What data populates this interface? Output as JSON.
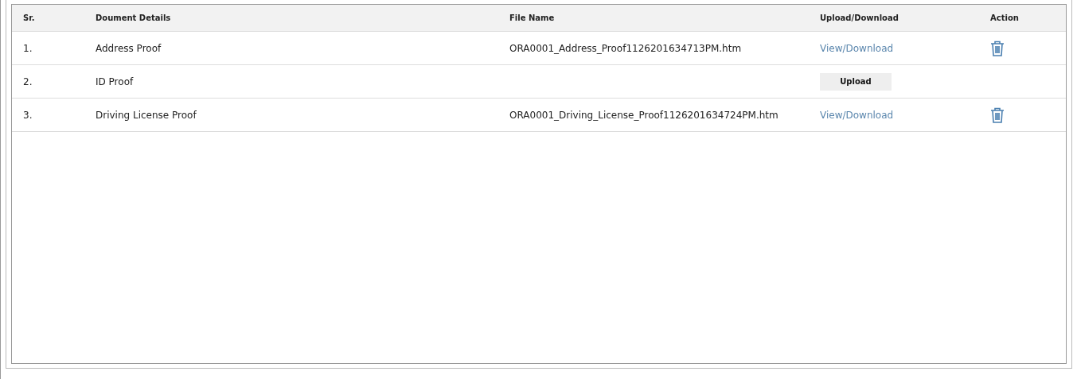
{
  "table": {
    "columns": [
      "Sr.",
      "Doument Details",
      "File Name",
      "Upload/Download",
      "Action"
    ],
    "rows": [
      {
        "sr": "1.",
        "document": "Address Proof",
        "file_name": "ORA0001_Address_Proof1126201634713PM.htm",
        "transfer": {
          "kind": "link",
          "label": "View/Download"
        },
        "deletable": true
      },
      {
        "sr": "2.",
        "document": "ID Proof",
        "transfer": {
          "kind": "button",
          "label": "Upload"
        },
        "deletable": false
      },
      {
        "sr": "3.",
        "document": "Driving License Proof",
        "file_name": "ORA0001_Driving_License_Proof1126201634724PM.htm",
        "transfer": {
          "kind": "link",
          "label": "View/Download"
        },
        "deletable": true
      }
    ]
  }
}
